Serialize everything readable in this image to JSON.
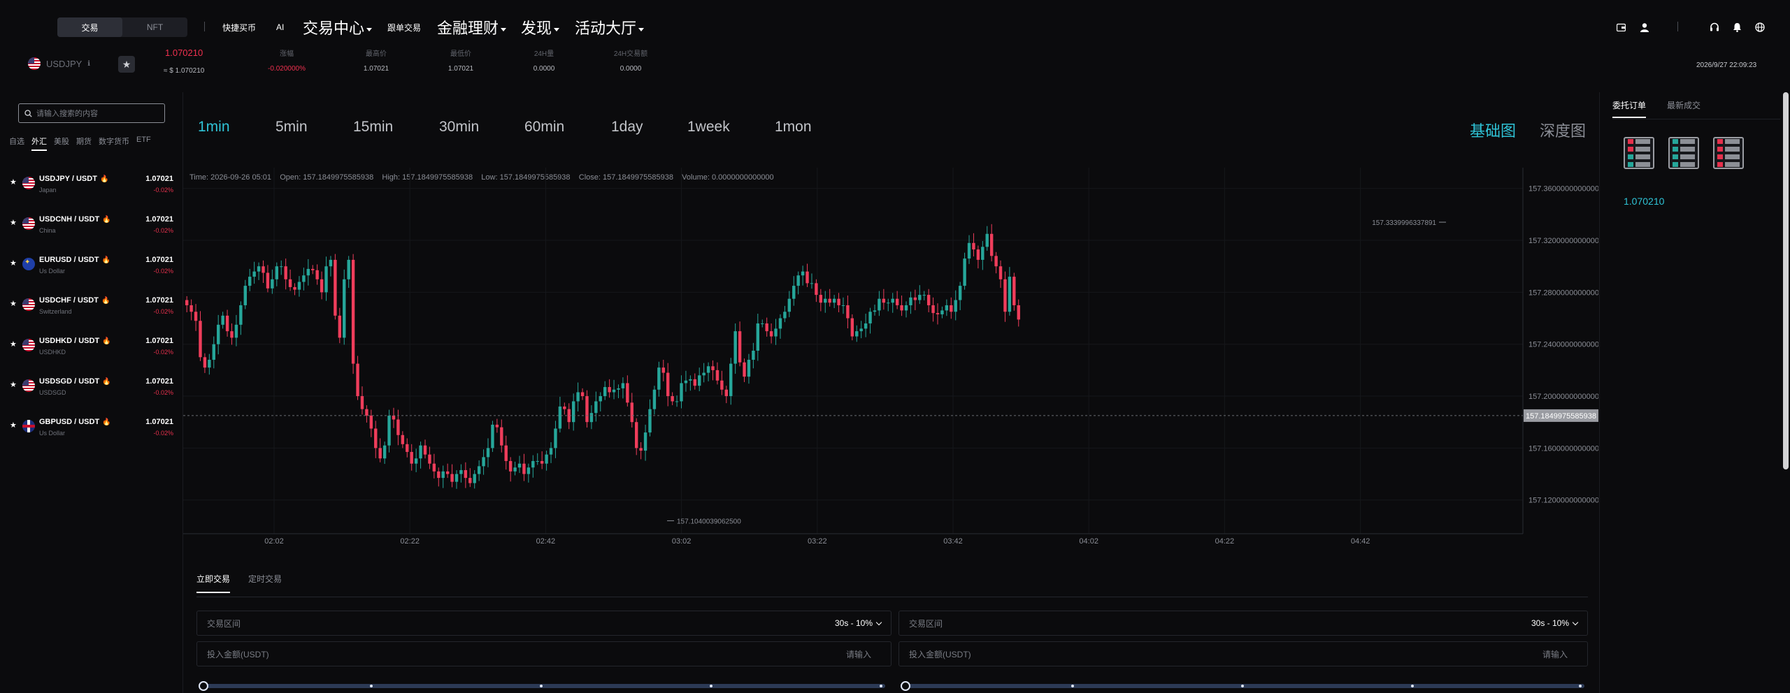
{
  "nav": {
    "segment": [
      "交易",
      "NFT"
    ],
    "links_small": [
      "快捷买币",
      "AI"
    ],
    "trade_center": "交易中心",
    "follow": "跟单交易",
    "finance": "金融理财",
    "discover": "发现",
    "events": "活动大厅",
    "icons": [
      "wallet-icon",
      "user-icon",
      "headset-icon",
      "bell-icon",
      "globe-icon"
    ]
  },
  "ticker": {
    "symbol": "USDJPY",
    "price": "1.070210",
    "price_usd": "≈ $ 1.070210",
    "stats": [
      {
        "label": "涨幅",
        "value": "-0.020000%"
      },
      {
        "label": "最高价",
        "value": "1.07021"
      },
      {
        "label": "最低价",
        "value": "1.07021"
      },
      {
        "label": "24H量",
        "value": "0.0000"
      },
      {
        "label": "24H交易额",
        "value": "0.0000"
      }
    ],
    "datetime": "2026/9/27 22:09:23"
  },
  "sidebar": {
    "search_placeholder": "请输入搜索的内容",
    "categories": [
      "自选",
      "外汇",
      "美股",
      "期货",
      "数字货币",
      "ETF"
    ],
    "active_category": "外汇",
    "pairs": [
      {
        "symbol": "USDJPY / USDT",
        "sub": "Japan",
        "price": "1.07021",
        "change": "-0.02%",
        "flag": "us"
      },
      {
        "symbol": "USDCNH / USDT",
        "sub": "China",
        "price": "1.07021",
        "change": "-0.02%",
        "flag": "us"
      },
      {
        "symbol": "EURUSD / USDT",
        "sub": "Us Dollar",
        "price": "1.07021",
        "change": "-0.02%",
        "flag": "eu"
      },
      {
        "symbol": "USDCHF / USDT",
        "sub": "Switzerland",
        "price": "1.07021",
        "change": "-0.02%",
        "flag": "us"
      },
      {
        "symbol": "USDHKD / USDT",
        "sub": "USDHKD",
        "price": "1.07021",
        "change": "-0.02%",
        "flag": "us"
      },
      {
        "symbol": "USDSGD / USDT",
        "sub": "USDSGD",
        "price": "1.07021",
        "change": "-0.02%",
        "flag": "us"
      },
      {
        "symbol": "GBPUSD / USDT",
        "sub": "Us Dollar",
        "price": "1.07021",
        "change": "-0.02%",
        "flag": "gb"
      }
    ]
  },
  "chart": {
    "intervals": [
      "1min",
      "5min",
      "15min",
      "30min",
      "60min",
      "1day",
      "1week",
      "1mon"
    ],
    "active_interval": "1min",
    "types": [
      "基础图",
      "深度图"
    ],
    "active_type": "基础图",
    "info": "Time: 2026-09-26 05:01    Open: 157.1849975585938    High: 157.1849975585938    Low: 157.1849975585938    Close: 157.1849975585938    Volume: 0.0000000000000",
    "high_label": "157.3339996337891",
    "low_label": "157.1040039062500",
    "current_label": "157.1849975585938"
  },
  "chart_data": {
    "type": "candlestick",
    "x_ticks": [
      "02:02",
      "02:22",
      "02:42",
      "03:02",
      "03:22",
      "03:42",
      "04:02",
      "04:22",
      "04:42"
    ],
    "y_ticks": [
      "157.3600000000000",
      "157.3200000000000",
      "157.2800000000000",
      "157.2400000000000",
      "157.2000000000000",
      "157.1600000000000",
      "157.1200000000000"
    ],
    "ylim": [
      157.094,
      157.376
    ],
    "current": 157.185,
    "high_mark": 157.334,
    "low_mark": 157.104,
    "up_color": "#26a69a",
    "down_color": "#ef3d5b",
    "closes": [
      157.27,
      157.265,
      157.258,
      157.23,
      157.222,
      157.228,
      157.24,
      157.255,
      157.262,
      157.25,
      157.245,
      157.255,
      157.27,
      157.285,
      157.292,
      157.296,
      157.3,
      157.295,
      157.283,
      157.29,
      157.3,
      157.3,
      157.29,
      157.284,
      157.282,
      157.288,
      157.293,
      157.298,
      157.297,
      157.29,
      157.28,
      157.3,
      157.305,
      157.262,
      157.245,
      157.29,
      157.305,
      157.225,
      157.2,
      157.19,
      157.185,
      157.175,
      157.16,
      157.152,
      157.162,
      157.185,
      157.182,
      157.17,
      157.163,
      157.157,
      157.148,
      157.152,
      157.162,
      157.155,
      157.148,
      157.142,
      157.137,
      157.142,
      157.14,
      157.134,
      157.14,
      157.143,
      157.137,
      157.133,
      157.14,
      157.146,
      157.153,
      157.16,
      157.178,
      157.176,
      157.162,
      157.15,
      157.142,
      157.145,
      157.148,
      157.14,
      157.145,
      157.15,
      157.15,
      157.148,
      157.155,
      157.16,
      157.175,
      157.192,
      157.19,
      157.18,
      157.196,
      157.203,
      157.2,
      157.18,
      157.187,
      157.196,
      157.2,
      157.207,
      157.203,
      157.205,
      157.206,
      157.21,
      157.195,
      157.18,
      157.16,
      157.158,
      157.172,
      157.19,
      157.205,
      157.222,
      157.218,
      157.2,
      157.196,
      157.196,
      157.21,
      157.212,
      157.213,
      157.208,
      157.216,
      157.218,
      157.223,
      157.22,
      157.212,
      157.205,
      157.2,
      157.225,
      157.25,
      157.226,
      157.215,
      157.228,
      157.235,
      157.256,
      157.256,
      157.25,
      157.246,
      157.252,
      157.26,
      157.265,
      157.275,
      157.285,
      157.293,
      157.296,
      157.287,
      157.287,
      157.278,
      157.272,
      157.275,
      157.272,
      157.275,
      157.27,
      157.27,
      157.26,
      157.246,
      157.25,
      157.252,
      157.256,
      157.265,
      157.266,
      157.275,
      157.272,
      157.272,
      157.275,
      157.27,
      157.266,
      157.27,
      157.276,
      157.274,
      157.278,
      157.278,
      157.27,
      157.264,
      157.263,
      157.266,
      157.27,
      157.265,
      157.274,
      157.285,
      157.306,
      157.318,
      157.313,
      157.305,
      157.315,
      157.325,
      157.308,
      157.3,
      157.29,
      157.265,
      157.292,
      157.27,
      157.259
    ]
  },
  "trade": {
    "tabs": [
      "立即交易",
      "定时交易"
    ],
    "active_tab": "立即交易",
    "range_label": "交易区间",
    "range_value": "30s - 10%",
    "amount_label": "投入金额(USDT)",
    "amount_placeholder": "请输入"
  },
  "orders": {
    "tabs": [
      "委托订单",
      "最新成交"
    ],
    "active_tab": "委托订单",
    "price": "1.070210"
  }
}
